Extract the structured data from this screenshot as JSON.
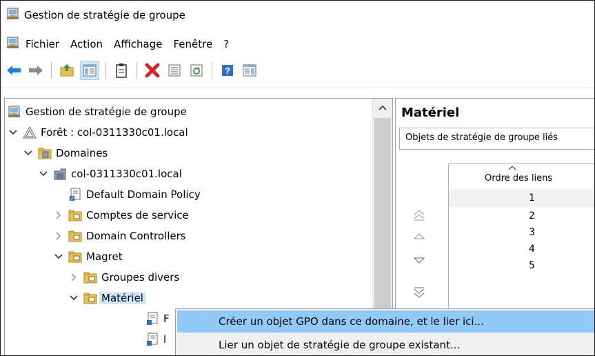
{
  "window": {
    "title": "Gestion de stratégie de groupe"
  },
  "menu": [
    "Fichier",
    "Action",
    "Affichage",
    "Fenêtre",
    "?"
  ],
  "toolbar": [
    "back-arrow-icon",
    "forward-arrow-icon",
    "up-folder-icon",
    "show-tree-icon",
    "properties-icon",
    "delete-icon",
    "export-list-icon",
    "refresh-icon",
    "help-icon",
    "console-pane-icon"
  ],
  "tree": {
    "root": "Gestion de stratégie de groupe",
    "forest": "Forêt : col-0311330c01.local",
    "domains": "Domaines",
    "domain": "col-0311330c01.local",
    "default_policy": "Default Domain Policy",
    "ou_service": "Comptes de service",
    "ou_dc": "Domain Controllers",
    "ou_magret": "Magret",
    "ou_groupes": "Groupes divers",
    "ou_materiel": "Matériel",
    "child_1_partial": "F",
    "child_2_partial": "l"
  },
  "right": {
    "title": "Matériel",
    "tab_label": "Objets de stratégie de groupe liés",
    "column_header": "Ordre des liens",
    "rows": [
      "1",
      "2",
      "3",
      "4",
      "5"
    ]
  },
  "context_menu": {
    "items": [
      "Créer un objet GPO dans ce domaine, et le lier ici...",
      "Lier un objet de stratégie de groupe existant..."
    ]
  },
  "colors": {
    "selection": "#cce8ff",
    "menu_hover": "#91c9f7",
    "folder": "#e8c156",
    "delete": "#e0201c",
    "nav_arrow": "#1d7fd8"
  }
}
